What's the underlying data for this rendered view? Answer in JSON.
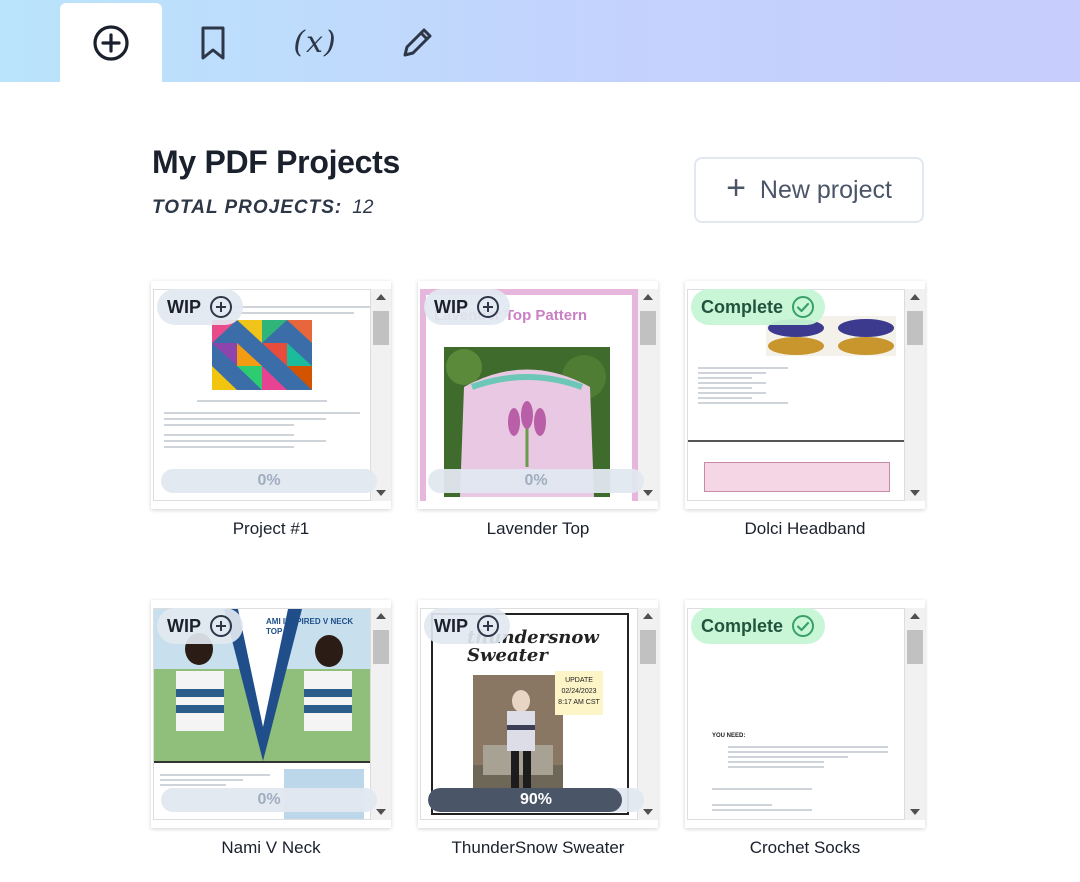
{
  "tabs": [
    {
      "name": "add",
      "icon": "plus-circle-icon",
      "active": true
    },
    {
      "name": "bookmark",
      "icon": "bookmark-icon",
      "active": false
    },
    {
      "name": "variables",
      "icon": "function-x-icon",
      "label": "(x)",
      "active": false
    },
    {
      "name": "edit",
      "icon": "pencil-icon",
      "active": false
    }
  ],
  "header": {
    "title": "My PDF Projects",
    "total_label": "TOTAL PROJECTS:",
    "total_value": "12",
    "new_button_label": "New project"
  },
  "projects": [
    {
      "title": "Project #1",
      "status": "WIP",
      "progress_label": "0%",
      "progress": 0
    },
    {
      "title": "Lavender Top",
      "status": "WIP",
      "progress_label": "0%",
      "progress": 0,
      "pdf_heading": "Lavender Top Pattern"
    },
    {
      "title": "Dolci Headband",
      "status": "Complete"
    },
    {
      "title": "Nami V Neck",
      "status": "WIP",
      "progress_label": "0%",
      "progress": 0,
      "pdf_heading": "AMI INSPIRED V NECK TOP"
    },
    {
      "title": "ThunderSnow Sweater",
      "status": "WIP",
      "progress_label": "90%",
      "progress": 90,
      "pdf_heading": "thundersnow Sweater",
      "pdf_update": [
        "UPDATE",
        "02/24/2023",
        "8:17 AM CST"
      ]
    },
    {
      "title": "Crochet Socks",
      "status": "Complete",
      "pdf_heading": "YOU NEED:"
    }
  ],
  "colors": {
    "wip_badge": "#e2e8f0",
    "complete_badge": "#c6f6d5",
    "complete_icon": "#38a169",
    "progress_fill": "#4a5568"
  }
}
